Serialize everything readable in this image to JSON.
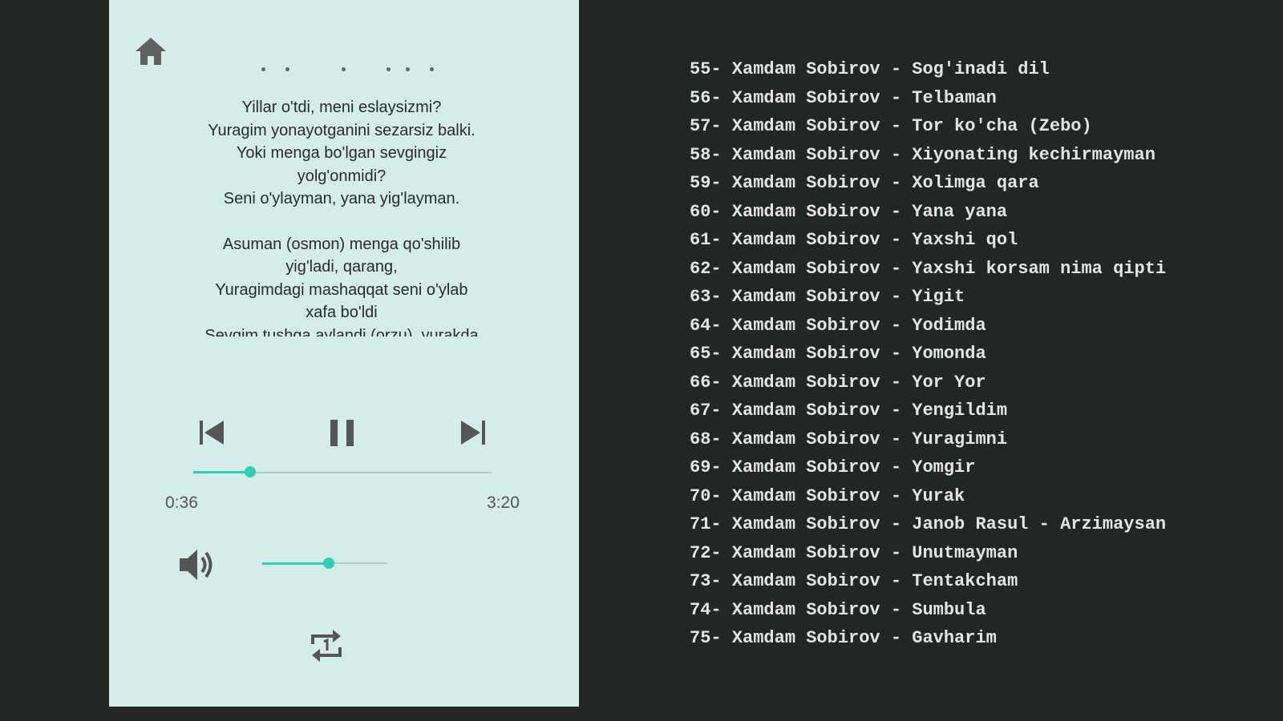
{
  "colors": {
    "accent": "#2ecfb7",
    "panel_bg": "#d4ede8",
    "dark_bg": "#232723"
  },
  "player": {
    "home_icon": "home-icon",
    "lyrics": [
      [
        "Yillar o'tdi, meni eslaysizmi?",
        "Yuragim yonayotganini sezarsiz balki.",
        "Yoki menga bo'lgan sevgingiz",
        "yolg'onmidi?",
        "Seni o'ylayman, yana yig'layman."
      ],
      [
        "Asuman (osmon) menga qo'shilib",
        "yig'ladi, qarang,",
        "Yuragimdagi mashaqqat seni o'ylab",
        "xafa bo'ldi",
        "Sevgim tushga aylandi (orzu), yurakda"
      ]
    ],
    "controls": {
      "prev_icon": "skip-previous-icon",
      "pause_icon": "pause-icon",
      "next_icon": "skip-next-icon",
      "volume_icon": "volume-icon",
      "repeat_icon": "repeat-one-icon"
    },
    "progress": {
      "elapsed": "0:36",
      "total": "3:20",
      "fraction": 0.19
    },
    "volume": {
      "fraction": 0.53
    }
  },
  "playlist": [
    "55- Xamdam Sobirov - Sog'inadi dil",
    "56- Xamdam Sobirov - Telbaman",
    "57- Xamdam Sobirov - Tor ko'cha (Zebo)",
    "58- Xamdam Sobirov - Xiyonating kechirmayman",
    "59- Xamdam Sobirov - Xolimga qara",
    "60- Xamdam Sobirov - Yana yana",
    "61- Xamdam Sobirov - Yaxshi qol",
    "62- Xamdam Sobirov - Yaxshi korsam nima qipti",
    "63- Xamdam Sobirov - Yigit",
    "64- Xamdam Sobirov - Yodimda",
    "65- Xamdam Sobirov - Yomonda",
    "66- Xamdam Sobirov - Yor Yor",
    "67- Xamdam Sobirov - Yengildim",
    "68- Xamdam Sobirov - Yuragimni",
    "69- Xamdam Sobirov - Yomgir",
    "70- Xamdam Sobirov - Yurak",
    "71- Xamdam Sobirov - Janob Rasul - Arzimaysan",
    "72- Xamdam Sobirov - Unutmayman",
    "73- Xamdam Sobirov - Tentakcham",
    "74- Xamdam Sobirov - Sumbula",
    "75- Xamdam Sobirov - Gavharim"
  ]
}
